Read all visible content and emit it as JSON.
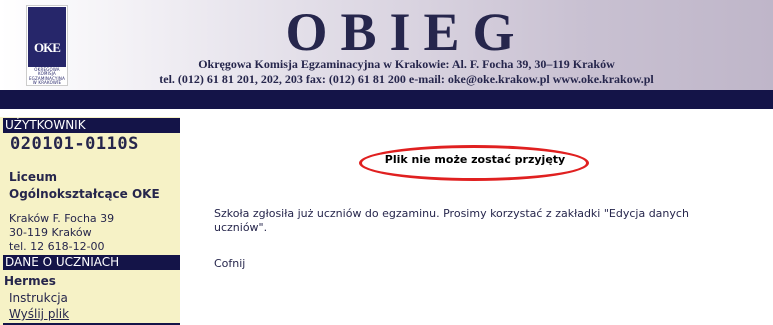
{
  "header": {
    "title": "OBIEG",
    "logo_mark": "OKE",
    "logo_text": "OKRĘGOWA KOMISJA EGZAMINACYJNA W KRAKOWIE",
    "address_line": "Okręgowa Komisja Egzaminacyjna w Krakowie:  Al. F. Focha 39, 30–119 Kraków",
    "contact_line": "tel. (012) 61 81 201, 202, 203  fax: (012) 61 81 200  e-mail: oke@oke.krakow.pl   www.oke.krakow.pl"
  },
  "sidebar": {
    "user_heading": "UŻYTKOWNIK",
    "user_id": "020101-0110S",
    "school_line1": "Liceum",
    "school_line2": "Ogólnokształcące OKE",
    "address_line1": "Kraków F. Focha 39",
    "address_line2": "30-119 Kraków",
    "phone": "tel. 12 618-12-00",
    "section_heading": "DANE O UCZNIACH",
    "app_name": "Hermes",
    "links": [
      "Instrukcja",
      "Wyślij plik"
    ]
  },
  "main": {
    "error_message": "Plik nie może zostać przyjęty",
    "body_text": "Szkoła zgłosiła już uczniów do egzaminu. Prosimy korzystać z zakładki \"Edycja danych uczniów\".",
    "back_link": "Cofnij"
  },
  "colors": {
    "navy": "#141448",
    "sidebar_bg": "#f6f2c6",
    "highlight": "#e02020"
  }
}
